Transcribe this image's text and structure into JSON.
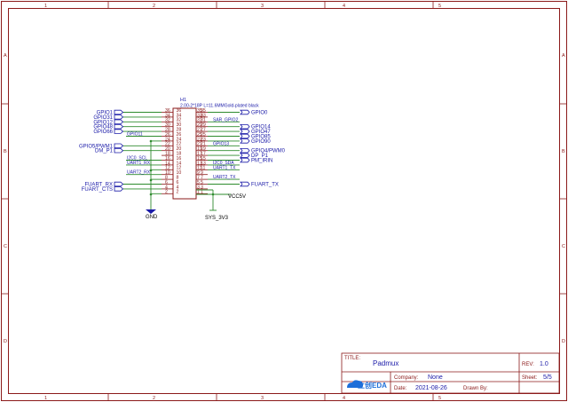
{
  "zones": {
    "columns": [
      "1",
      "2",
      "3",
      "4",
      "5"
    ],
    "rows": [
      "A",
      "B",
      "C",
      "D"
    ]
  },
  "component": {
    "designator": "H1",
    "value": "2.00-2*18P L=11.6MMGold-plated black"
  },
  "left_pins": [
    {
      "a": "36",
      "b": "36",
      "net": "",
      "port": "GPIO1"
    },
    {
      "a": "34",
      "b": "34",
      "net": "",
      "port": "GPIO31"
    },
    {
      "a": "32",
      "b": "32",
      "net": "",
      "port": "GPIO12"
    },
    {
      "a": "30",
      "b": "30",
      "net": "",
      "port": "GPIO48"
    },
    {
      "a": "28",
      "b": "28",
      "net": "",
      "port": "GPIO66"
    },
    {
      "a": "26",
      "b": "26",
      "net": "GPIO11",
      "port": ""
    },
    {
      "a": "24",
      "b": "24",
      "net": "",
      "port": ""
    },
    {
      "a": "22",
      "b": "22",
      "net": "",
      "port": "GPIO5/PWM1"
    },
    {
      "a": "20",
      "b": "20",
      "net": "",
      "port": "DM_P1"
    },
    {
      "a": "18",
      "b": "18",
      "net": "",
      "port": ""
    },
    {
      "a": "16",
      "b": "16",
      "net": "I2C0_SCL",
      "port": ""
    },
    {
      "a": "14",
      "b": "14",
      "net": "UART1_RX",
      "port": ""
    },
    {
      "a": "12",
      "b": "12",
      "net": "",
      "port": ""
    },
    {
      "a": "10",
      "b": "10",
      "net": "UART2_RX",
      "port": ""
    },
    {
      "a": "8",
      "b": "8",
      "net": "",
      "port": ""
    },
    {
      "a": "6",
      "b": "6",
      "net": "",
      "port": "FUART_RX"
    },
    {
      "a": "4",
      "b": "4",
      "net": "",
      "port": "FUART_CTS"
    },
    {
      "a": "2",
      "b": "2",
      "net": "",
      "port": ""
    }
  ],
  "right_pins": [
    {
      "a": "35",
      "b": "35",
      "net": "",
      "port": "GPIO0"
    },
    {
      "a": "33",
      "b": "33",
      "net": "",
      "port": ""
    },
    {
      "a": "31",
      "b": "31",
      "net": "SAR_GPIO2",
      "port": ""
    },
    {
      "a": "29",
      "b": "29",
      "net": "",
      "port": "GPIO14"
    },
    {
      "a": "27",
      "b": "27",
      "net": "",
      "port": "GPIO47"
    },
    {
      "a": "25",
      "b": "25",
      "net": "",
      "port": "GPIO85"
    },
    {
      "a": "23",
      "b": "23",
      "net": "",
      "port": "GPIO90"
    },
    {
      "a": "21",
      "b": "21",
      "net": "GPIO13",
      "port": ""
    },
    {
      "a": "19",
      "b": "19",
      "net": "",
      "port": "GPIO4/PWM0"
    },
    {
      "a": "17",
      "b": "17",
      "net": "",
      "port": "DP_P1"
    },
    {
      "a": "15",
      "b": "15",
      "net": "",
      "port": "PM_IRIN"
    },
    {
      "a": "13",
      "b": "13",
      "net": "I2C0_SDA",
      "port": ""
    },
    {
      "a": "11",
      "b": "11",
      "net": "UART1_TX",
      "port": ""
    },
    {
      "a": "9",
      "b": "9",
      "net": "",
      "port": ""
    },
    {
      "a": "7",
      "b": "7",
      "net": "UART2_TX",
      "port": ""
    },
    {
      "a": "5",
      "b": "5",
      "net": "",
      "port": "FUART_TX"
    },
    {
      "a": "3",
      "b": "3",
      "net": "",
      "port": ""
    },
    {
      "a": "1",
      "b": "1",
      "net": "",
      "port": ""
    }
  ],
  "power": {
    "gnd": "GND",
    "vcc5": "VCC5V",
    "sys33": "SYS_3V3"
  },
  "title_block": {
    "title_label": "TITLE:",
    "title": "Padmux",
    "rev_label": "REV:",
    "rev": "1.0",
    "company_label": "Company:",
    "company": "None",
    "sheet_label": "Sheet:",
    "sheet": "5/5",
    "date_label": "Date:",
    "date": "2021-08-26",
    "drawn_label": "Drawn By:",
    "drawn": "",
    "logo_text": "立创EDA"
  }
}
